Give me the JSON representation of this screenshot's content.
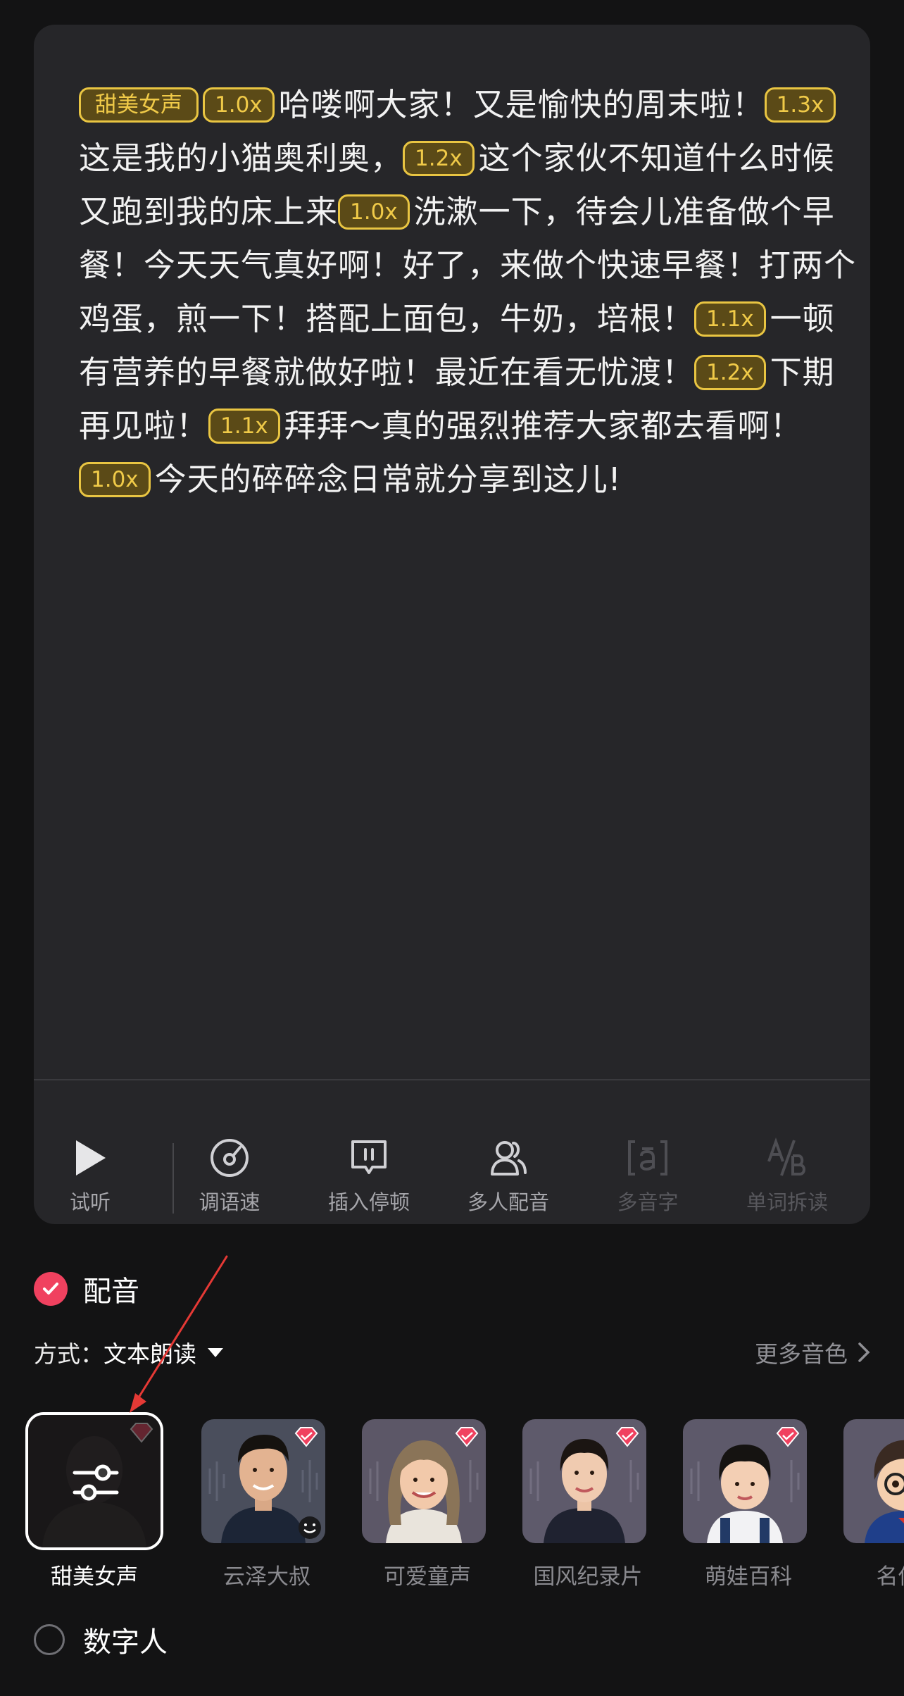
{
  "editor": {
    "segments": [
      {
        "type": "tag",
        "text": "甜美女声",
        "kind": "voice"
      },
      {
        "type": "tag",
        "text": "1.0x"
      },
      {
        "type": "text",
        "text": "哈喽啊大家！又是愉快的周末啦！"
      },
      {
        "type": "tag",
        "text": "1.3x"
      },
      {
        "type": "text",
        "text": "这是我的小猫奥利奥，"
      },
      {
        "type": "tag",
        "text": "1.2x"
      },
      {
        "type": "text",
        "text": "这个家伙不知道什么时候又跑到我的床上来"
      },
      {
        "type": "tag",
        "text": "1.0x"
      },
      {
        "type": "text",
        "text": "洗漱一下，待会儿准备做个早餐！今天天气真好啊！好了，来做个快速早餐！打两个鸡蛋，煎一下！搭配上面包，牛奶，培根！"
      },
      {
        "type": "tag",
        "text": "1.1x"
      },
      {
        "type": "text",
        "text": "一顿有营养的早餐就做好啦！最近在看无忧渡！"
      },
      {
        "type": "tag",
        "text": "1.2x"
      },
      {
        "type": "text",
        "text": "下期再见啦！"
      },
      {
        "type": "tag",
        "text": "1.1x"
      },
      {
        "type": "text",
        "text": "拜拜～真的强烈推荐大家都去看啊！"
      },
      {
        "type": "tag",
        "text": "1.0x"
      },
      {
        "type": "text",
        "text": "今天的碎碎念日常就分享到这儿!"
      }
    ]
  },
  "toolbar": {
    "preview": "试听",
    "speed": "调语速",
    "pause": "插入停顿",
    "multi": "多人配音",
    "polyphone": "多音字",
    "split": "单词拆读"
  },
  "dubbing": {
    "label": "配音",
    "mode_prefix": "方式：",
    "mode_value": "文本朗读",
    "more_voices": "更多音色"
  },
  "voices": [
    {
      "name": "甜美女声",
      "selected": true
    },
    {
      "name": "云泽大叔"
    },
    {
      "name": "可爱童声"
    },
    {
      "name": "国风纪录片"
    },
    {
      "name": "萌娃百科"
    },
    {
      "name": "名侦探"
    }
  ],
  "digital_human": {
    "label": "数字人"
  },
  "colors": {
    "tag_border": "#e9c542",
    "tag_text": "#f0ca48",
    "check_red": "#f0415f",
    "annotation_arrow": "#e53935"
  }
}
